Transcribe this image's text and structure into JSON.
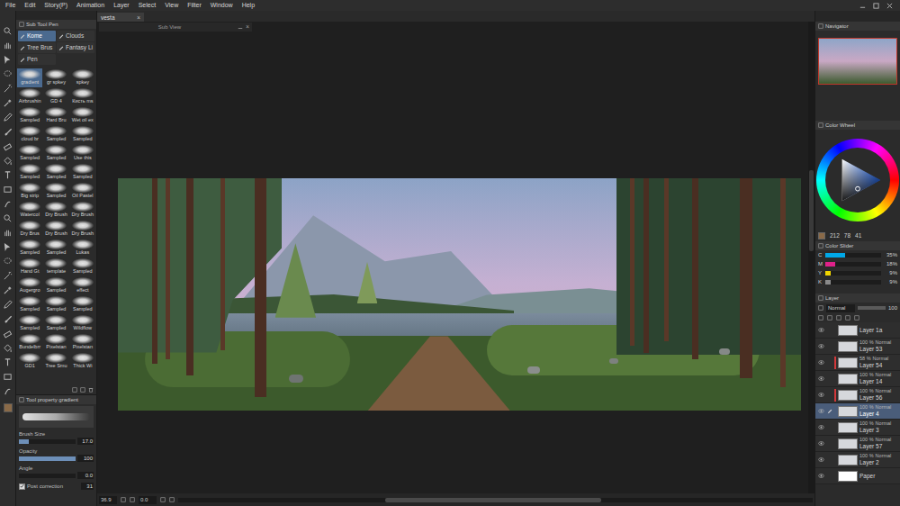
{
  "menu": [
    "File",
    "Edit",
    "Story(P)",
    "Animation",
    "Layer",
    "Select",
    "View",
    "Filter",
    "Window",
    "Help"
  ],
  "document_tab": {
    "label": "vesta",
    "close": "×"
  },
  "sub_view": {
    "title": "Sub View",
    "close": "×"
  },
  "sub_tool": {
    "title": "Sub Tool Pen",
    "groups": [
      {
        "label": "Kome",
        "selected": true
      },
      {
        "label": "Clouds",
        "selected": false
      },
      {
        "label": "Tree Brus",
        "selected": false
      },
      {
        "label": "Fantasy Li",
        "selected": false
      },
      {
        "label": "Pen",
        "selected": false
      }
    ],
    "brushes": [
      {
        "label": "gradient",
        "selected": true
      },
      {
        "label": "gr spkey",
        "selected": false
      },
      {
        "label": "spkey",
        "selected": false
      },
      {
        "label": "Airbrushin",
        "selected": false
      },
      {
        "label": "GD 4",
        "selected": false
      },
      {
        "label": "Кисть ms",
        "selected": false
      },
      {
        "label": "Sampled",
        "selected": false
      },
      {
        "label": "Hard Bru",
        "selected": false
      },
      {
        "label": "Wet oil ex",
        "selected": false
      },
      {
        "label": "cloud br",
        "selected": false
      },
      {
        "label": "Sampled",
        "selected": false
      },
      {
        "label": "Sampled",
        "selected": false
      },
      {
        "label": "Sampled",
        "selected": false
      },
      {
        "label": "Sampled",
        "selected": false
      },
      {
        "label": "Use this",
        "selected": false
      },
      {
        "label": "Sampled",
        "selected": false
      },
      {
        "label": "Sampled",
        "selected": false
      },
      {
        "label": "Sampled",
        "selected": false
      },
      {
        "label": "Big strip",
        "selected": false
      },
      {
        "label": "Sampled",
        "selected": false
      },
      {
        "label": "Oil Pastel",
        "selected": false
      },
      {
        "label": "Watercol",
        "selected": false
      },
      {
        "label": "Dry Brush",
        "selected": false
      },
      {
        "label": "Dry Brush",
        "selected": false
      },
      {
        "label": "Dry Brus",
        "selected": false
      },
      {
        "label": "Dry Brush",
        "selected": false
      },
      {
        "label": "Dry Brush",
        "selected": false
      },
      {
        "label": "Sampled",
        "selected": false
      },
      {
        "label": "Sampled",
        "selected": false
      },
      {
        "label": "Lukas",
        "selected": false
      },
      {
        "label": "Hand Gt",
        "selected": false
      },
      {
        "label": "template",
        "selected": false
      },
      {
        "label": "Sampled",
        "selected": false
      },
      {
        "label": "Augergro",
        "selected": false
      },
      {
        "label": "Sampled",
        "selected": false
      },
      {
        "label": "effect",
        "selected": false
      },
      {
        "label": "Sampled",
        "selected": false
      },
      {
        "label": "Sampled",
        "selected": false
      },
      {
        "label": "Sampled",
        "selected": false
      },
      {
        "label": "Sampled",
        "selected": false
      },
      {
        "label": "Sampled",
        "selected": false
      },
      {
        "label": "Wildflow",
        "selected": false
      },
      {
        "label": "Bundelbrr",
        "selected": false
      },
      {
        "label": "Pixelstan",
        "selected": false
      },
      {
        "label": "Pixelstan",
        "selected": false
      },
      {
        "label": "GD1",
        "selected": false
      },
      {
        "label": "Tree Smu",
        "selected": false
      },
      {
        "label": "Thick Wi",
        "selected": false
      }
    ]
  },
  "tool_property": {
    "title": "Tool property gradient",
    "properties": [
      {
        "label": "Brush Size",
        "value": "17.0",
        "level": 0.17
      },
      {
        "label": "Opacity",
        "value": "100",
        "level": 1
      },
      {
        "label": "Angle",
        "value": "0.0",
        "level": 0
      }
    ],
    "post_correction": {
      "label": "Post correction",
      "checked": true,
      "value": "31"
    }
  },
  "status_bar": {
    "zoom": "36.9",
    "angle": "0.0"
  },
  "navigator": {
    "title": "Navigator"
  },
  "color_wheel": {
    "title": "Color Wheel",
    "values": [
      "212",
      "78",
      "41"
    ]
  },
  "color_slider": {
    "title": "Color Slider",
    "channels": [
      {
        "name": "C",
        "reading": "35%",
        "level": 0.35,
        "color": "#00a8e8"
      },
      {
        "name": "M",
        "reading": "18%",
        "level": 0.18,
        "color": "#e0218a"
      },
      {
        "name": "Y",
        "reading": "9%",
        "level": 0.09,
        "color": "#f2d600"
      },
      {
        "name": "K",
        "reading": "9%",
        "level": 0.09,
        "color": "#8a8a8a"
      }
    ]
  },
  "layer_panel": {
    "title": "Layer",
    "blend": "Normal",
    "opacity": "100",
    "layers": [
      {
        "name": "Layer 1a",
        "kind": "partial",
        "visible": true,
        "selected": false,
        "flag": false
      },
      {
        "opacity": "100 %",
        "blend": "Normal",
        "name": "Layer 53",
        "kind": "layer",
        "visible": true,
        "selected": false,
        "flag": false
      },
      {
        "opacity": "58 %",
        "blend": "Normal",
        "name": "Layer 54",
        "kind": "layer",
        "visible": true,
        "selected": false,
        "flag": true
      },
      {
        "opacity": "100 %",
        "blend": "Normal",
        "name": "Layer 14",
        "kind": "layer",
        "visible": true,
        "selected": false,
        "flag": false
      },
      {
        "opacity": "100 %",
        "blend": "Normal",
        "name": "Layer 56",
        "kind": "layer",
        "visible": true,
        "selected": false,
        "flag": true
      },
      {
        "opacity": "100 %",
        "blend": "Normal",
        "name": "Layer 4",
        "kind": "layer",
        "visible": true,
        "selected": true,
        "flag": false
      },
      {
        "opacity": "100 %",
        "blend": "Normal",
        "name": "Layer 3",
        "kind": "layer",
        "visible": true,
        "selected": false,
        "flag": false
      },
      {
        "opacity": "100 %",
        "blend": "Normal",
        "name": "Layer 57",
        "kind": "layer",
        "visible": true,
        "selected": false,
        "flag": false
      },
      {
        "opacity": "100 %",
        "blend": "Normal",
        "name": "Layer 2",
        "kind": "layer",
        "visible": true,
        "selected": false,
        "flag": false
      },
      {
        "name": "Paper",
        "kind": "paper",
        "visible": true,
        "selected": false,
        "flag": false
      }
    ]
  }
}
